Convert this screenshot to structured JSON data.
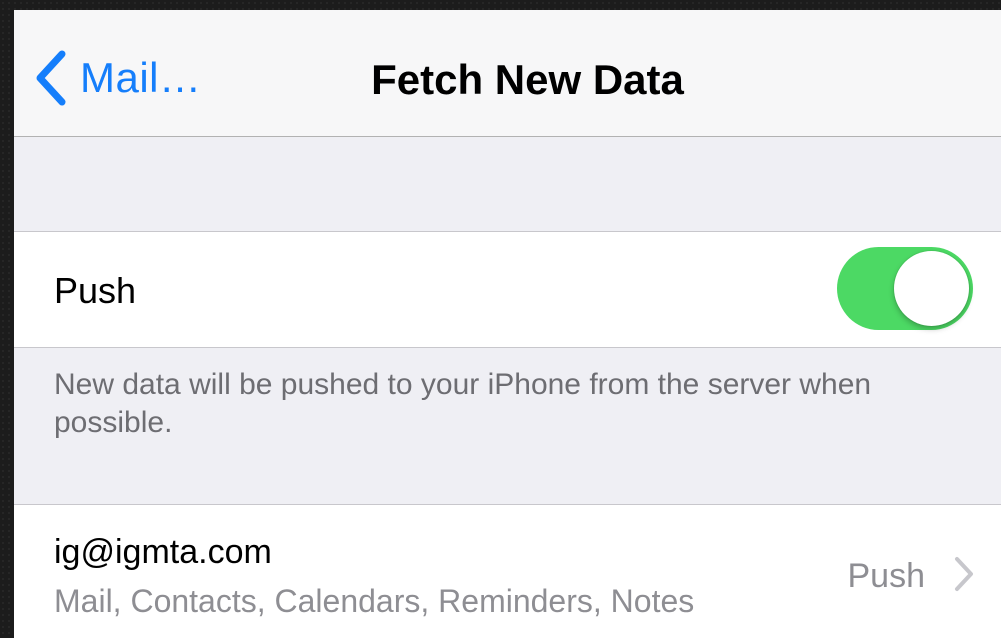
{
  "navbar": {
    "back_label": "Mail…",
    "title": "Fetch New Data"
  },
  "push": {
    "label": "Push",
    "enabled": true,
    "footer": "New data will be pushed to your iPhone from the server when possible."
  },
  "accounts": [
    {
      "email": "ig@igmta.com",
      "services": "Mail, Contacts, Calendars, Reminders, Notes",
      "value": "Push"
    }
  ],
  "colors": {
    "accent": "#157efb",
    "toggle_on": "#4cd964",
    "secondary_text": "#8e8e93",
    "background": "#efeff4"
  }
}
